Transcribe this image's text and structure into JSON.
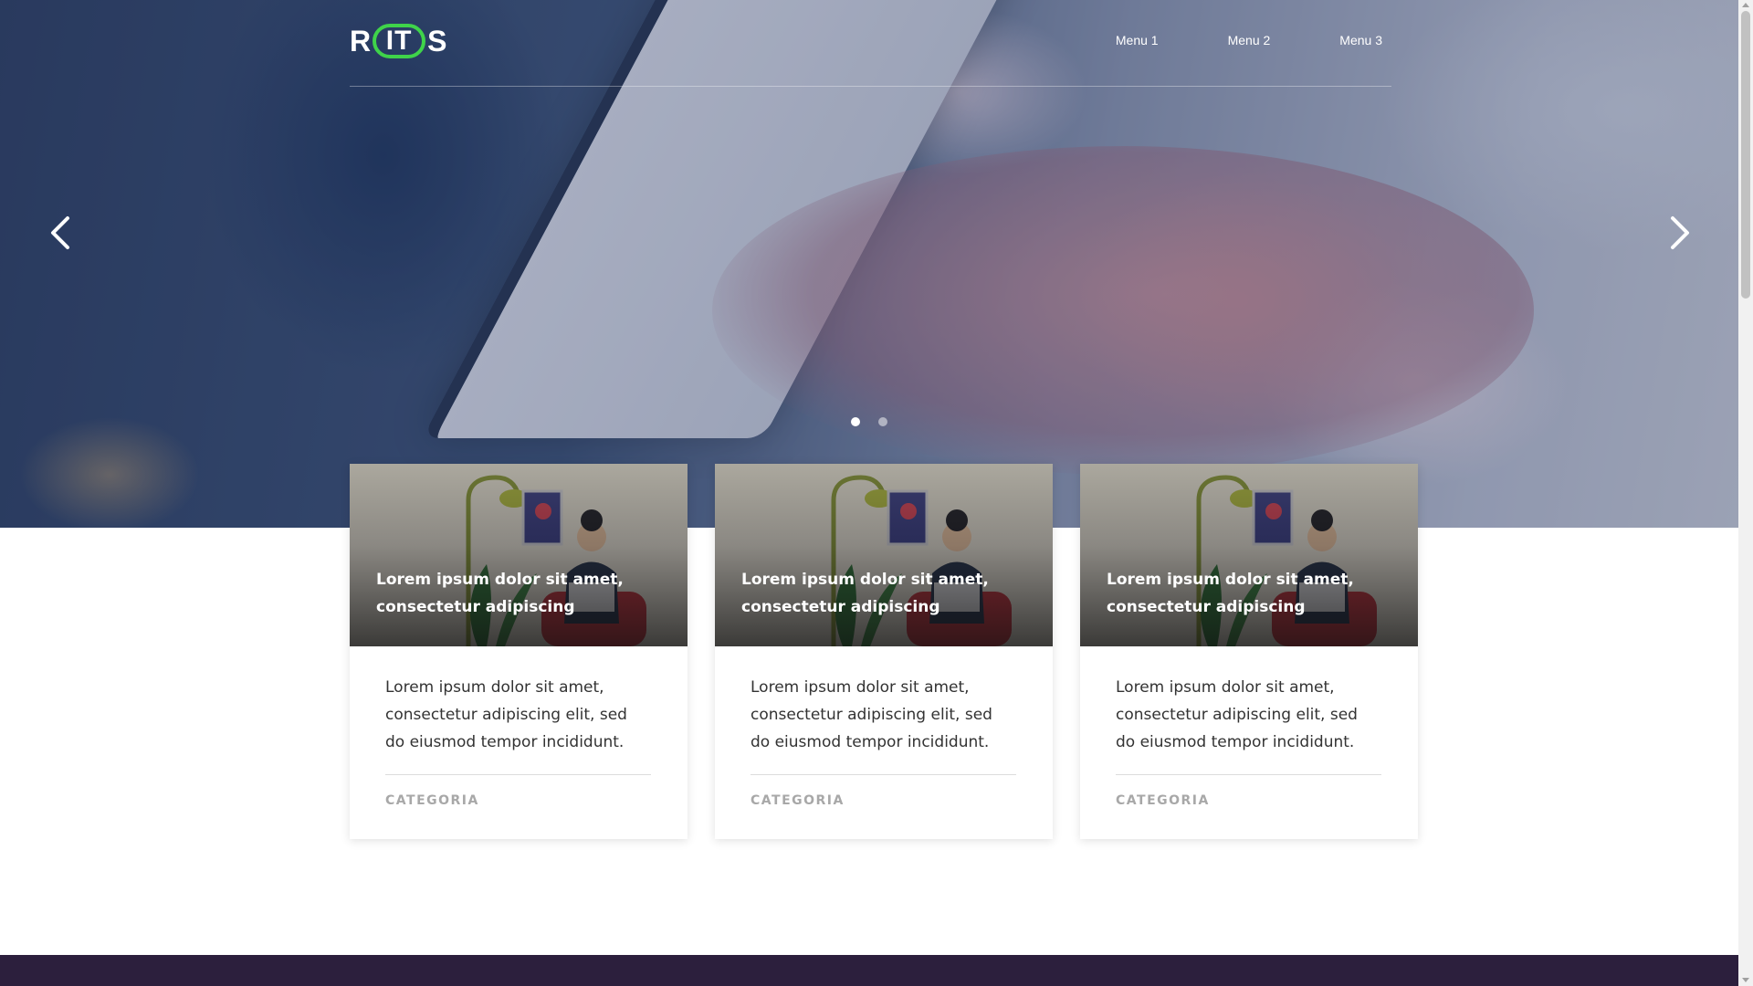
{
  "logo": {
    "left": "R",
    "middle": "IT",
    "right": "S",
    "accent_color": "#3fd34a"
  },
  "nav": {
    "items": [
      "Menu 1",
      "Menu 2",
      "Menu 3"
    ]
  },
  "carousel": {
    "prev_icon": "chevron-left-icon",
    "next_icon": "chevron-right-icon",
    "slide_count": 2,
    "active_slide": 1
  },
  "cards": [
    {
      "title": "Lorem ipsum dolor sit amet, consectetur adipiscing",
      "text": "Lorem ipsum dolor sit amet, consectetur adipiscing elit, sed do eiusmod tempor incididunt.",
      "category": "CATEGORIA"
    },
    {
      "title": "Lorem ipsum dolor sit amet, consectetur adipiscing",
      "text": "Lorem ipsum dolor sit amet, consectetur adipiscing elit, sed do eiusmod tempor incididunt.",
      "category": "CATEGORIA"
    },
    {
      "title": "Lorem ipsum dolor sit amet, consectetur adipiscing",
      "text": "Lorem ipsum dolor sit amet, consectetur adipiscing elit, sed do eiusmod tempor incididunt.",
      "category": "CATEGORIA"
    }
  ],
  "colors": {
    "footer": "#2c1f3d",
    "category_text": "#a8a8a8"
  }
}
